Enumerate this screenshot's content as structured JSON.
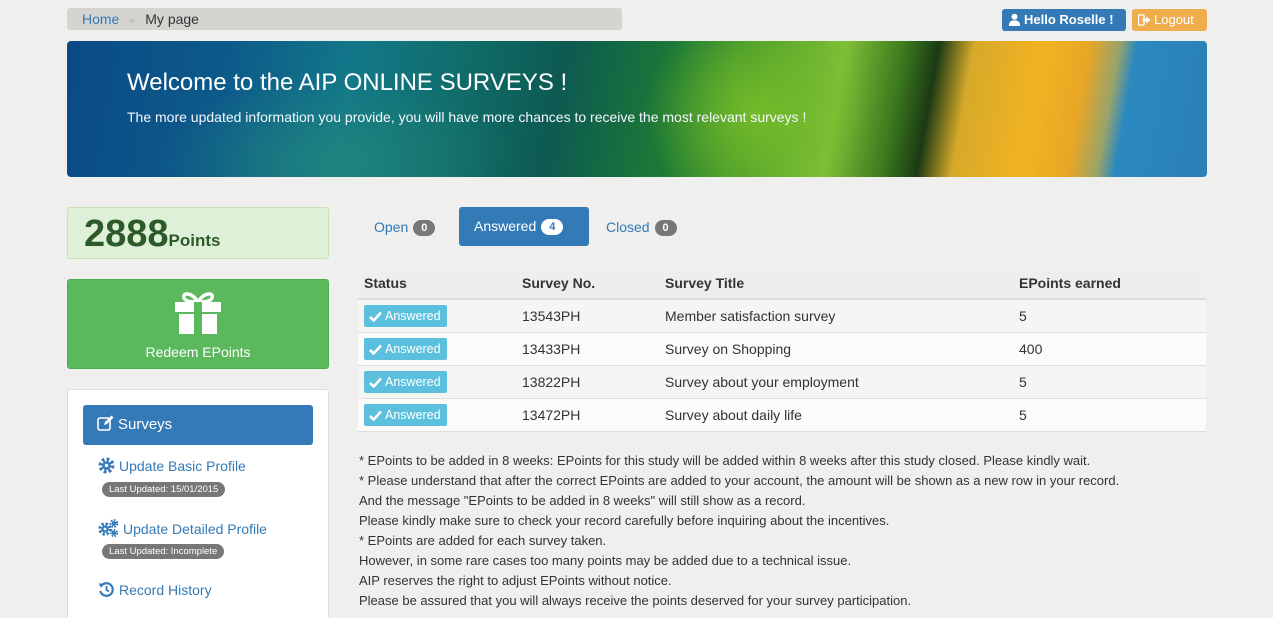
{
  "breadcrumb": {
    "home": "Home",
    "separator": "»",
    "current": "My page"
  },
  "header": {
    "hello": "Hello Roselle !",
    "logout": "Logout"
  },
  "banner": {
    "title": "Welcome to the AIP ONLINE SURVEYS !",
    "subtitle": "The more updated information you provide, you will have more chances to receive the most relevant surveys !"
  },
  "points": {
    "value": "2888",
    "label": "Points"
  },
  "redeem": {
    "label": "Redeem EPoints",
    "icon": "gift-icon"
  },
  "sidebar": {
    "active": {
      "label": "Surveys",
      "icon": "edit-icon"
    },
    "links": [
      {
        "label": "Update Basic Profile",
        "badge": "Last Updated: 15/01/2015",
        "icon": "gear-icon"
      },
      {
        "label": "Update Detailed Profile",
        "badge": "Last Updated: Incomplete",
        "icon": "gears-icon"
      },
      {
        "label": "Record History",
        "icon": "history-icon"
      }
    ]
  },
  "tabs": [
    {
      "label": "Open",
      "count": "0"
    },
    {
      "label": "Answered",
      "count": "4"
    },
    {
      "label": "Closed",
      "count": "0"
    }
  ],
  "table": {
    "headers": [
      "Status",
      "Survey No.",
      "Survey Title",
      "EPoints earned"
    ],
    "rows": [
      {
        "status": "Answered",
        "no": "13543PH",
        "title": "Member satisfaction survey",
        "points": "5"
      },
      {
        "status": "Answered",
        "no": "13433PH",
        "title": "Survey on Shopping",
        "points": "400"
      },
      {
        "status": "Answered",
        "no": "13822PH",
        "title": "Survey about your employment",
        "points": "5"
      },
      {
        "status": "Answered",
        "no": "13472PH",
        "title": "Survey about daily life",
        "points": "5"
      }
    ]
  },
  "notes": [
    "* EPoints to be added in 8 weeks: EPoints for this study will be added within 8 weeks after this study closed. Please kindly wait.",
    "* Please understand that after the correct EPoints are added to your account, the amount will be shown as a new row in your record.",
    "And the message \"EPoints to be added in 8 weeks\" will still show as a record.",
    "Please kindly make sure to check your record carefully before inquiring about the incentives.",
    "* EPoints are added for each survey taken.",
    "However, in some rare cases too many points may be added due to a technical issue.",
    "AIP reserves the right to adjust EPoints without notice.",
    "Please be assured that you will always receive the points deserved for your survey participation."
  ],
  "colors": {
    "primary": "#337ab7",
    "success": "#5cb85c",
    "info": "#5bc0de",
    "warning": "#f0ad4e"
  }
}
